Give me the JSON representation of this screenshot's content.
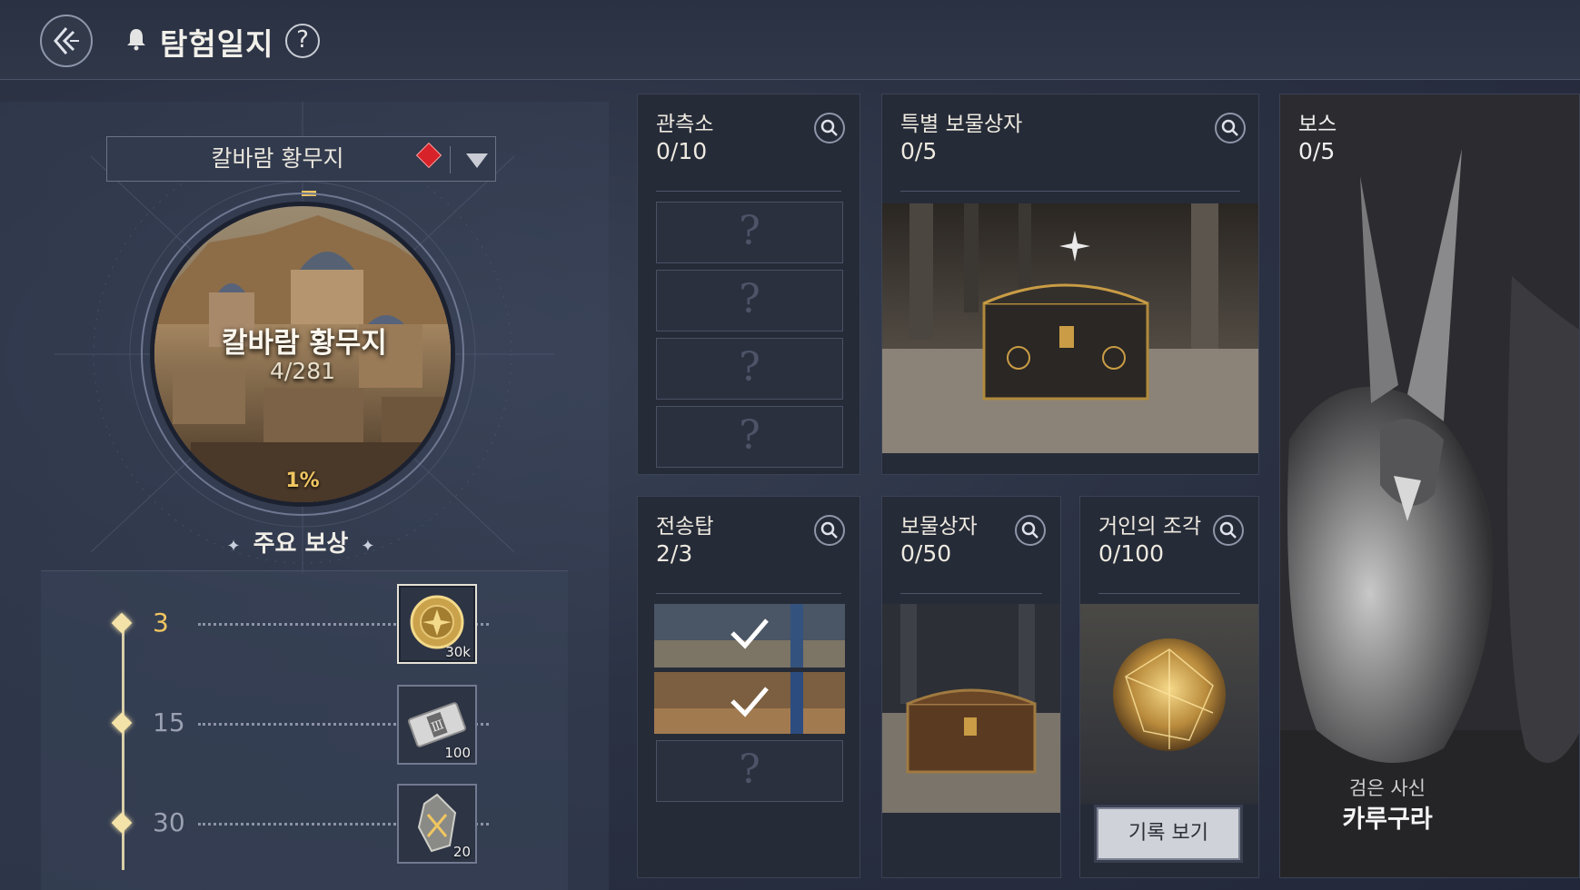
{
  "header": {
    "title": "탐험일지",
    "help": "?"
  },
  "region": {
    "selected": "칼바람 황무지",
    "name": "칼바람 황무지",
    "progress_text": "4/281",
    "percent_text": "1%",
    "percent": 1
  },
  "rewards": {
    "title": "주요 보상",
    "items": [
      {
        "level": "3",
        "qty": "30k",
        "icon": "gold-coin-icon"
      },
      {
        "level": "15",
        "qty": "100",
        "icon": "ticket-icon"
      },
      {
        "level": "30",
        "qty": "20",
        "icon": "crystal-icon"
      }
    ]
  },
  "cards": {
    "observatory": {
      "title": "관측소",
      "count": "0/10",
      "slot": "?"
    },
    "special_chest": {
      "title": "특별 보물상자",
      "count": "0/5"
    },
    "boss": {
      "title": "보스",
      "count": "0/5",
      "subtitle": "검은 사신",
      "name": "카루구라"
    },
    "teleport": {
      "title": "전송탑",
      "count": "2/3",
      "slot": "?"
    },
    "chest": {
      "title": "보물상자",
      "count": "0/50"
    },
    "giant": {
      "title": "거인의 조각",
      "count": "0/100",
      "button": "기록 보기"
    }
  },
  "colors": {
    "accent_gold": "#f0c661",
    "panel": "#262b38",
    "background": "#2b3244"
  }
}
